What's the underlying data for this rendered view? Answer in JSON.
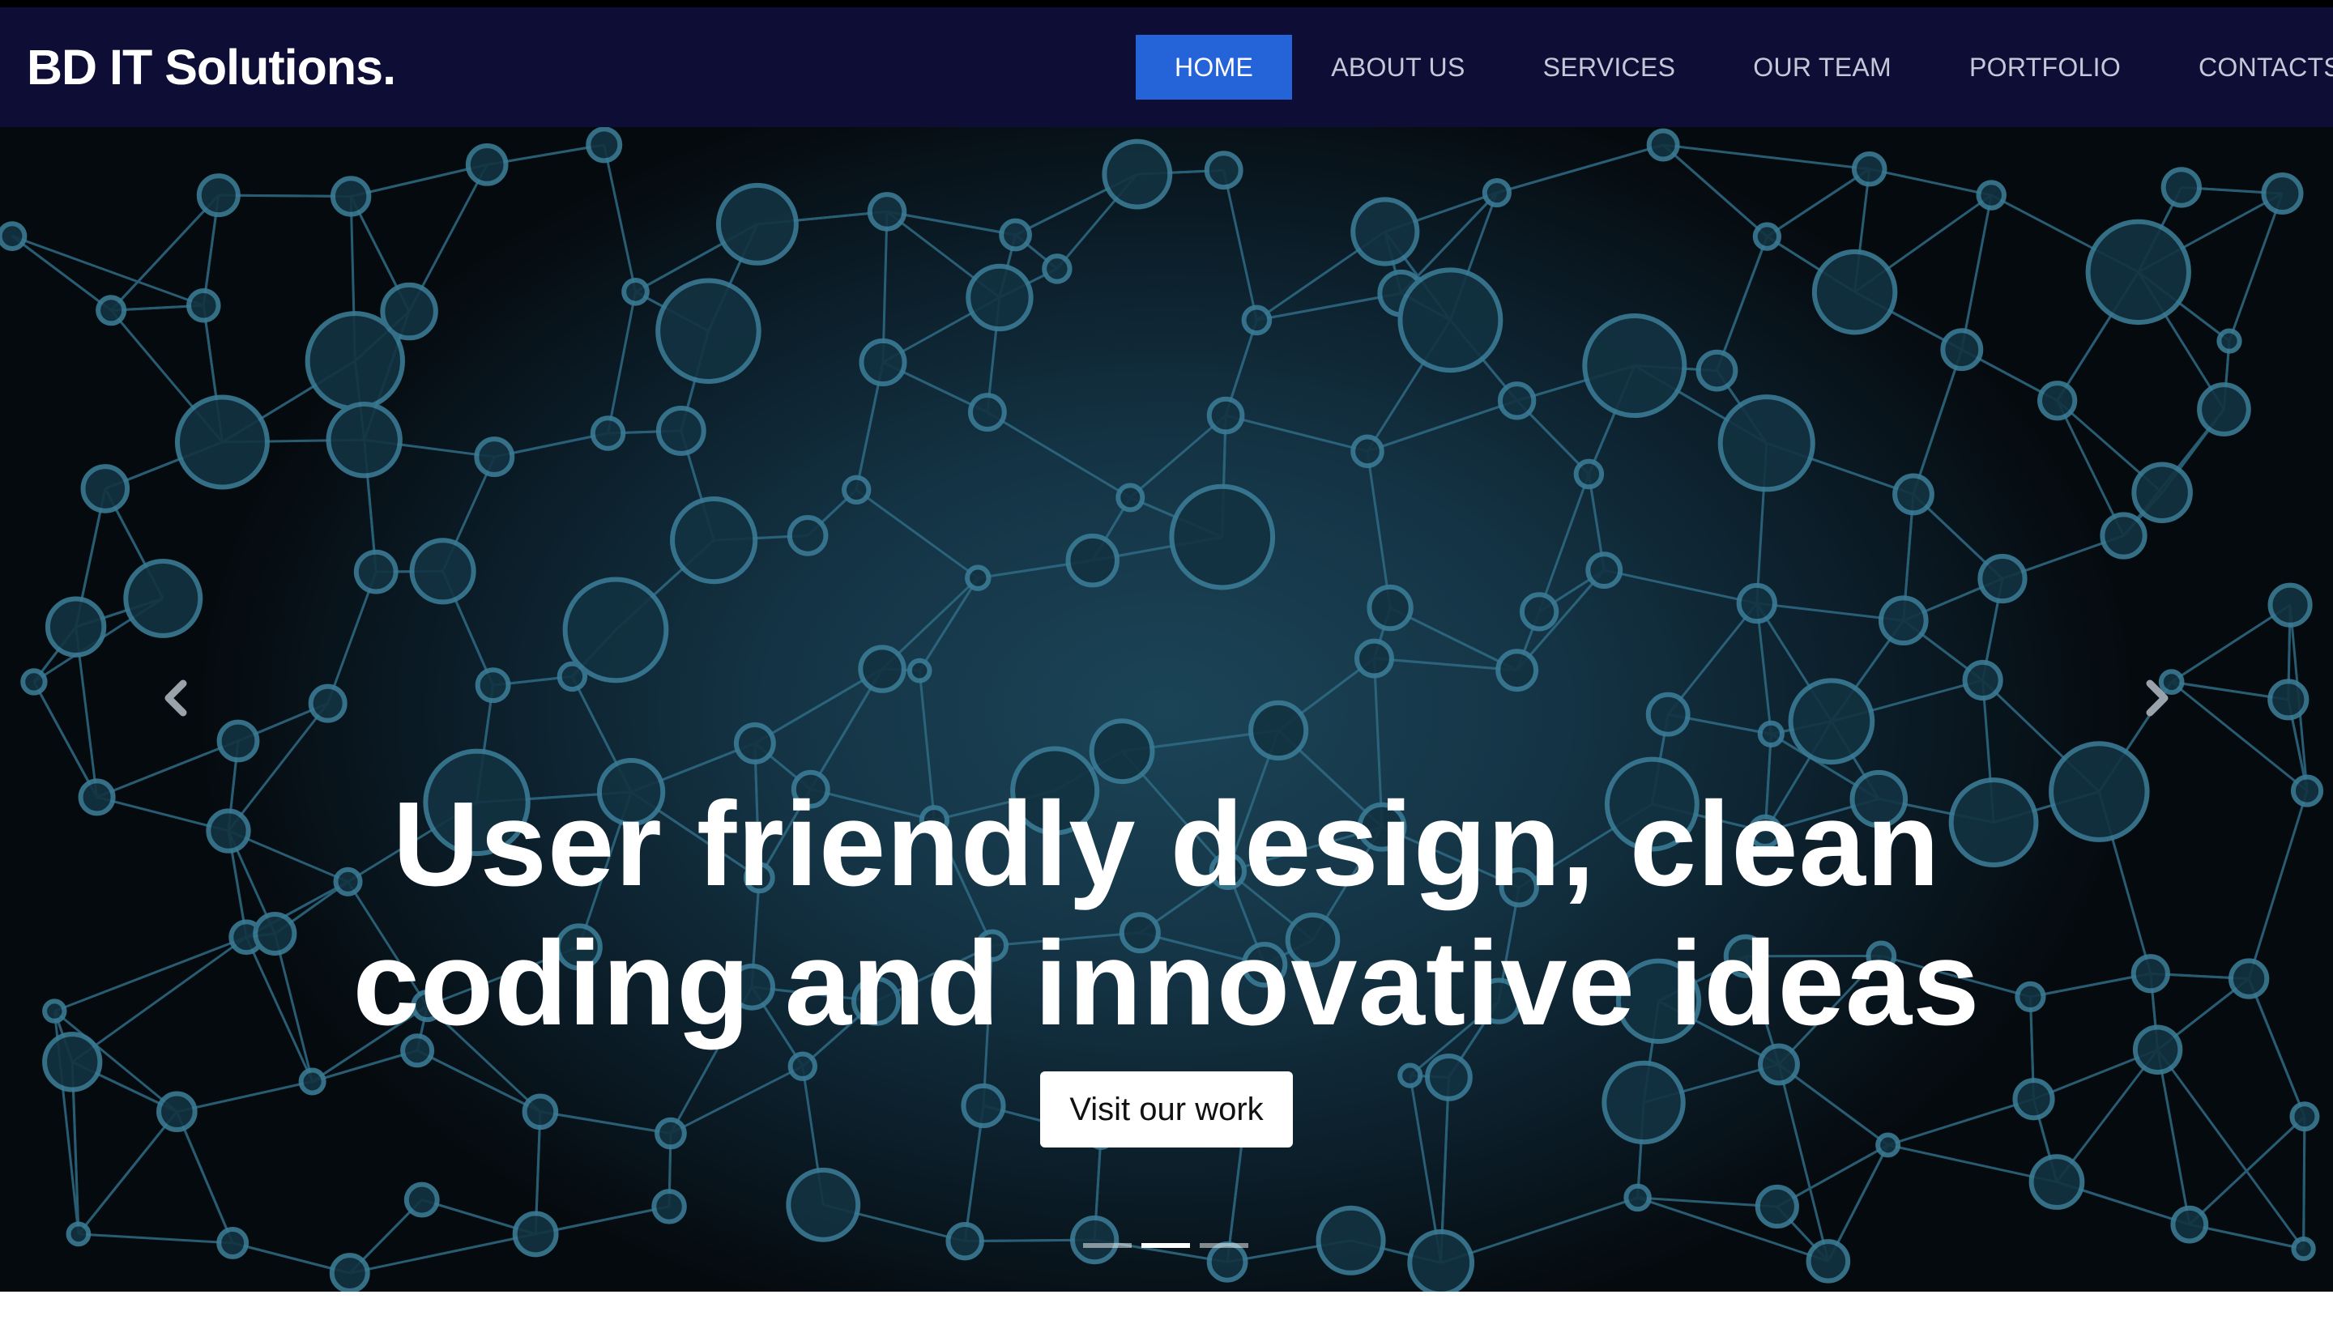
{
  "brand": {
    "name": "BD IT Solutions."
  },
  "nav": {
    "items": [
      {
        "label": "HOME",
        "active": true
      },
      {
        "label": "ABOUT US",
        "active": false
      },
      {
        "label": "SERVICES",
        "active": false
      },
      {
        "label": "OUR TEAM",
        "active": false
      },
      {
        "label": "PORTFOLIO",
        "active": false
      },
      {
        "label": "CONTACTS",
        "active": false
      }
    ]
  },
  "hero": {
    "headline_line1": "User friendly design, clean",
    "headline_line2": "coding and innovative ideas",
    "cta_label": "Visit our work",
    "background_icon": "network-nodes-pattern",
    "prev_icon": "chevron-left-icon",
    "next_icon": "chevron-right-icon",
    "slides_total": 3,
    "active_slide": 2
  },
  "colors": {
    "navbar_bg": "#0e0d36",
    "nav_active_bg": "#2563d8",
    "hero_node_stroke": "#3a7a94"
  }
}
